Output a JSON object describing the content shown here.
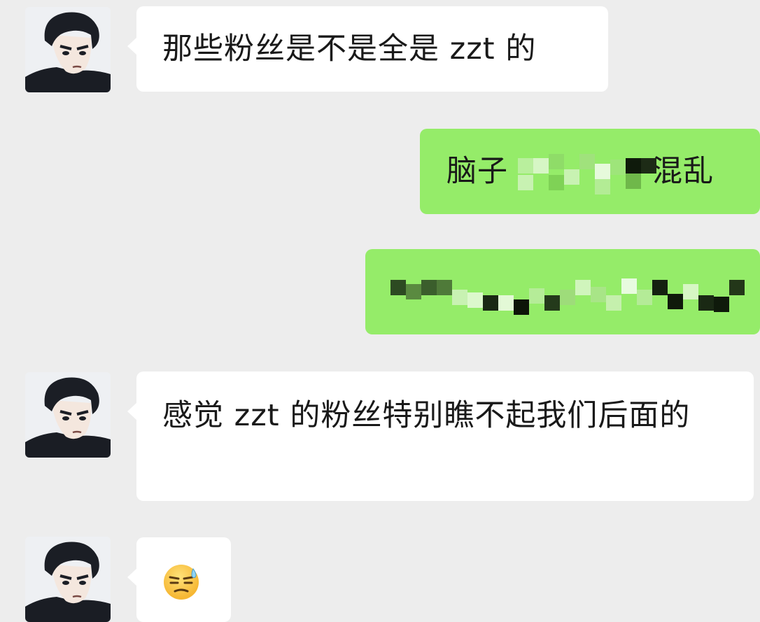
{
  "conversation": {
    "messages": [
      {
        "side": "incoming",
        "type": "text",
        "text": "那些粉丝是不是全是 zzt 的"
      },
      {
        "side": "outgoing",
        "type": "text",
        "text": "脑子",
        "redacted_suffix": "混乱",
        "redacted": true
      },
      {
        "side": "outgoing",
        "type": "text",
        "text": "",
        "redacted": true
      },
      {
        "side": "incoming",
        "type": "text",
        "text": "感觉 zzt 的粉丝特别瞧不起我们后面的"
      },
      {
        "side": "incoming",
        "type": "emoji",
        "icon": "awkward-sweat-emoji-icon"
      }
    ]
  },
  "colors": {
    "background": "#ededed",
    "incoming_bubble": "#ffffff",
    "outgoing_bubble": "#95ec69",
    "text": "#191919"
  }
}
